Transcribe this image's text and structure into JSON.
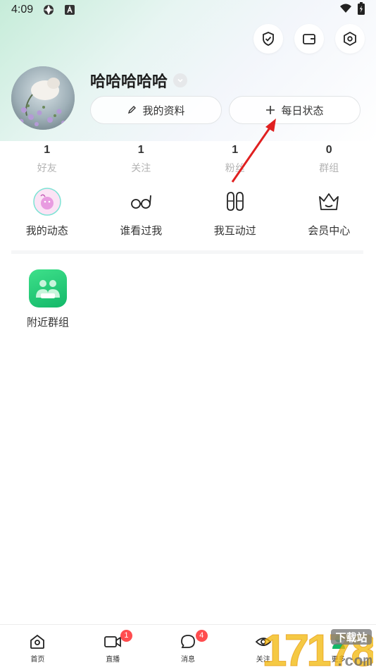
{
  "status_bar": {
    "time": "4:09"
  },
  "profile": {
    "username": "哈哈哈哈哈",
    "btn_profile": "我的资料",
    "btn_status": "每日状态"
  },
  "stats": [
    {
      "num": "1",
      "label": "好友"
    },
    {
      "num": "1",
      "label": "关注"
    },
    {
      "num": "1",
      "label": "粉丝"
    },
    {
      "num": "0",
      "label": "群组"
    }
  ],
  "features": [
    {
      "label": "我的动态",
      "icon": "moments-avatar-icon"
    },
    {
      "label": "谁看过我",
      "icon": "glasses-icon"
    },
    {
      "label": "我互动过",
      "icon": "footprints-icon"
    },
    {
      "label": "会员中心",
      "icon": "crown-icon"
    }
  ],
  "nearby": {
    "label": "附近群组",
    "icon": "nearby-groups-icon"
  },
  "nav": [
    {
      "label": "首页",
      "badge": ""
    },
    {
      "label": "直播",
      "badge": "1"
    },
    {
      "label": "消息",
      "badge": "4"
    },
    {
      "label": "关注",
      "badge": ""
    },
    {
      "label": "更多",
      "badge": ""
    }
  ],
  "watermark": {
    "digits": "17178",
    "text": "下载站",
    "domain": ".com"
  },
  "colors": {
    "accent_green": "#13b869",
    "badge_red": "#ff4d4f",
    "arrow_red": "#e02020"
  }
}
